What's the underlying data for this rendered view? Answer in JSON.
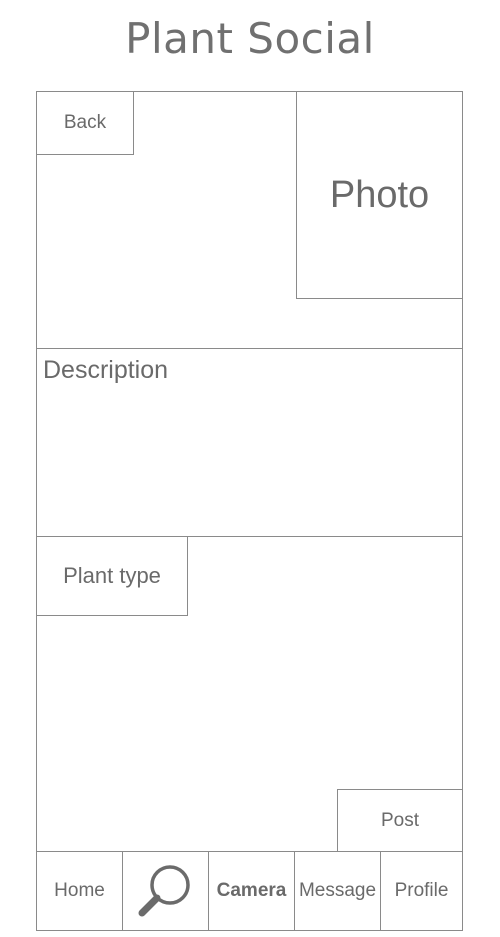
{
  "app": {
    "title": "Plant Social"
  },
  "top": {
    "back_label": "Back",
    "photo_label": "Photo"
  },
  "description": {
    "label": "Description"
  },
  "plant_type": {
    "label": "Plant type"
  },
  "actions": {
    "post_label": "Post"
  },
  "tabbar": {
    "home_label": "Home",
    "search_icon": "search-icon",
    "camera_label": "Camera",
    "message_label": "Message",
    "profile_label": "Profile"
  },
  "colors": {
    "stroke": "#8a8a8a",
    "text": "#6a6a6a",
    "icon": "#6b6b6b"
  }
}
